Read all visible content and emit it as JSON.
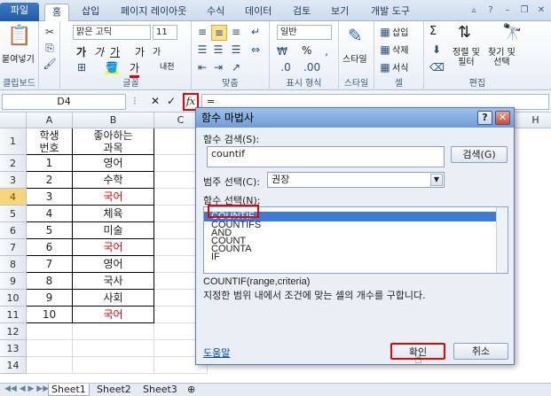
{
  "ribbon_tabs": [
    "파일",
    "홈",
    "삽입",
    "페이지 레이아웃",
    "수식",
    "데이터",
    "검토",
    "보기",
    "개발 도구"
  ],
  "ribbon": {
    "clipboard": {
      "paste": "붙여넣기",
      "label": "클립보드"
    },
    "font": {
      "name": "맑은 고딕",
      "size": "11",
      "label": "글꼴",
      "grow": "가",
      "shrink": "가",
      "bold": "가",
      "italic": "가",
      "underline": "가",
      "color_char": "가",
      "phonetic": "내천"
    },
    "align": {
      "label": "맞춤"
    },
    "number": {
      "format": "일반",
      "label": "표시 형식",
      "percent": "%"
    },
    "styles": {
      "label": "스타일"
    },
    "cells": {
      "insert": "삽입",
      "delete": "삭제",
      "format": "서식",
      "label": "셀"
    },
    "editing": {
      "sort": "정렬 및\n필터",
      "find": "찾기 및\n선택",
      "label": "편집",
      "sigma": "Σ"
    }
  },
  "formula_bar": {
    "name_box": "D4",
    "fx": "fx",
    "formula": "="
  },
  "grid": {
    "columns": [
      "A",
      "B",
      "C",
      "H"
    ],
    "header": {
      "a1": "학생\n번호",
      "b1": "좋아하는\n과목"
    },
    "rows": [
      {
        "n": "1",
        "a": "1",
        "b": "영어",
        "red": false
      },
      {
        "n": "2",
        "a": "2",
        "b": "수학",
        "red": false
      },
      {
        "n": "3",
        "a": "3",
        "b": "국어",
        "red": true
      },
      {
        "n": "4",
        "a": "4",
        "b": "체육",
        "red": false
      },
      {
        "n": "5",
        "a": "5",
        "b": "미술",
        "red": false
      },
      {
        "n": "6",
        "a": "6",
        "b": "국어",
        "red": true
      },
      {
        "n": "7",
        "a": "7",
        "b": "영어",
        "red": false
      },
      {
        "n": "8",
        "a": "8",
        "b": "국사",
        "red": false
      },
      {
        "n": "9",
        "a": "9",
        "b": "사회",
        "red": false
      },
      {
        "n": "10",
        "a": "10",
        "b": "국어",
        "red": true
      }
    ],
    "row_numbers": [
      "1",
      "2",
      "3",
      "4",
      "5",
      "6",
      "7",
      "8",
      "9",
      "10",
      "11",
      "12",
      "13",
      "14"
    ]
  },
  "sheets": [
    "Sheet1",
    "Sheet2",
    "Sheet3"
  ],
  "dialog": {
    "title": "함수 마법사",
    "search_label": "함수 검색(S):",
    "search_value": "countif",
    "search_button": "검색(G)",
    "category_label": "범주 선택(C):",
    "category_value": "권장",
    "select_label": "함수 선택(N):",
    "functions": [
      "COUNTIF",
      "COUNTIFS",
      "AND",
      "COUNT",
      "COUNTA",
      "IF"
    ],
    "signature": "COUNTIF(range,criteria)",
    "description": "지정한 범위 내에서 조건에 맞는 셀의 개수를 구합니다.",
    "help_link": "도움말",
    "ok": "확인",
    "cancel": "취소",
    "help_button": "?",
    "close_button": "✕"
  }
}
